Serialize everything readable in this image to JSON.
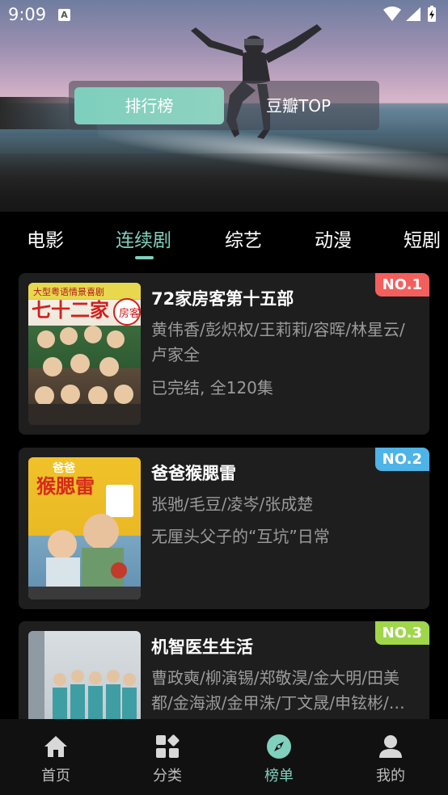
{
  "status_bar": {
    "time": "9:09",
    "notification_glyph": "A"
  },
  "header_switch": {
    "tabs": [
      "排行榜",
      "豆瓣TOP"
    ],
    "active_index": 0
  },
  "category_tabs": {
    "items": [
      "电影",
      "连续剧",
      "综艺",
      "动漫",
      "短剧"
    ],
    "active_index": 1
  },
  "rankings": [
    {
      "rank": "NO.1",
      "badge_color": "#f25f5c",
      "title": "72家房客第十五部",
      "cast": "黄伟香/彭炽权/王莉莉/容晖/林星云/卢家全",
      "desc": "已完结, 全120集"
    },
    {
      "rank": "NO.2",
      "badge_color": "#4eb3e6",
      "title": "爸爸猴腮雷",
      "cast": "张驰/毛豆/凌岑/张成楚",
      "desc": "无厘头父子的“互坑”日常"
    },
    {
      "rank": "NO.3",
      "badge_color": "#9fd64a",
      "title": "机智医生生活",
      "cast": "曹政奭/柳演锡/郑敬淏/金大明/田美都/金海淑/金甲洙/丁文晟/申铉彬/…",
      "desc": ""
    }
  ],
  "bottom_nav": {
    "items": [
      {
        "label": "首页",
        "icon": "home-icon"
      },
      {
        "label": "分类",
        "icon": "category-icon"
      },
      {
        "label": "榜单",
        "icon": "compass-icon"
      },
      {
        "label": "我的",
        "icon": "profile-icon"
      }
    ],
    "active_index": 2
  },
  "colors": {
    "accent": "#7fd0bd",
    "card_bg": "#1e1e1e",
    "nav_bg": "#111111"
  }
}
